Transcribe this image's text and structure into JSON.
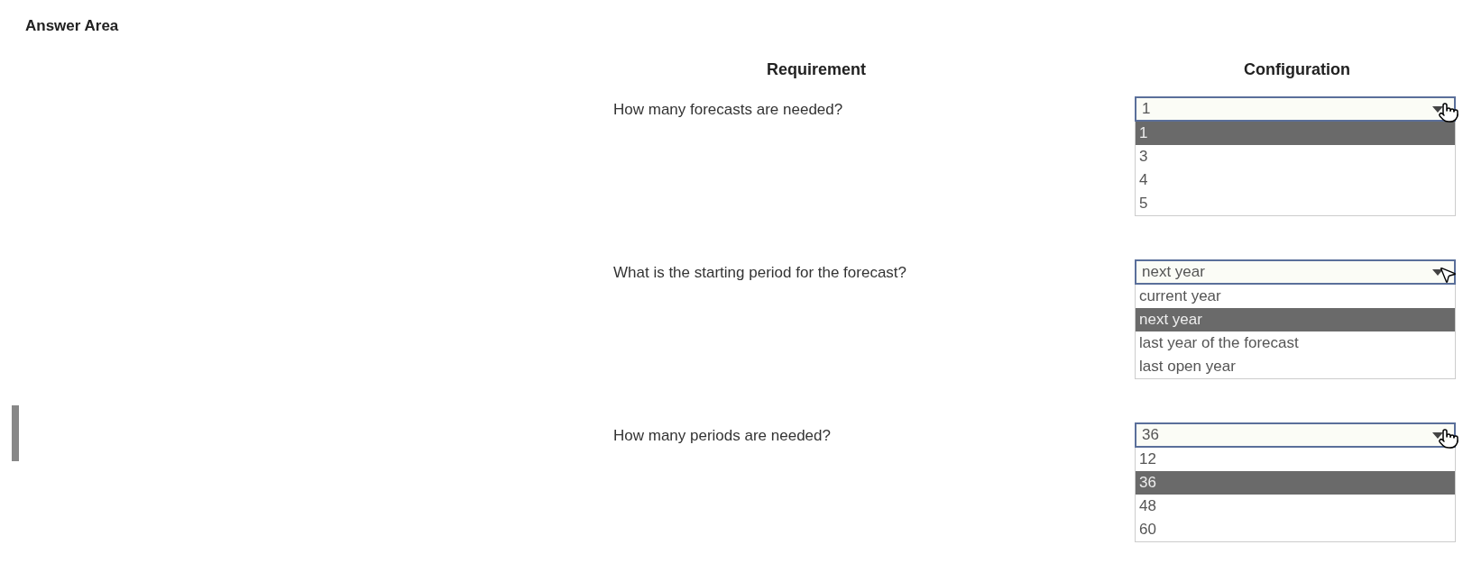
{
  "title": "Answer Area",
  "headers": {
    "requirement": "Requirement",
    "configuration": "Configuration"
  },
  "rows": [
    {
      "question": "How many forecasts are needed?",
      "value": "1",
      "kind": "hand",
      "options": [
        {
          "label": "1",
          "selected": true
        },
        {
          "label": "3",
          "selected": false
        },
        {
          "label": "4",
          "selected": false
        },
        {
          "label": "5",
          "selected": false
        }
      ]
    },
    {
      "question": "What is the starting period for the forecast?",
      "value": "next year",
      "kind": "arrow",
      "options": [
        {
          "label": "current year",
          "selected": false
        },
        {
          "label": "next year",
          "selected": true
        },
        {
          "label": "last year of the forecast",
          "selected": false
        },
        {
          "label": "last open year",
          "selected": false
        }
      ]
    },
    {
      "question": "How many periods are needed?",
      "value": "36",
      "kind": "hand",
      "options": [
        {
          "label": "12",
          "selected": false
        },
        {
          "label": "36",
          "selected": true
        },
        {
          "label": "48",
          "selected": false
        },
        {
          "label": "60",
          "selected": false
        }
      ]
    }
  ]
}
